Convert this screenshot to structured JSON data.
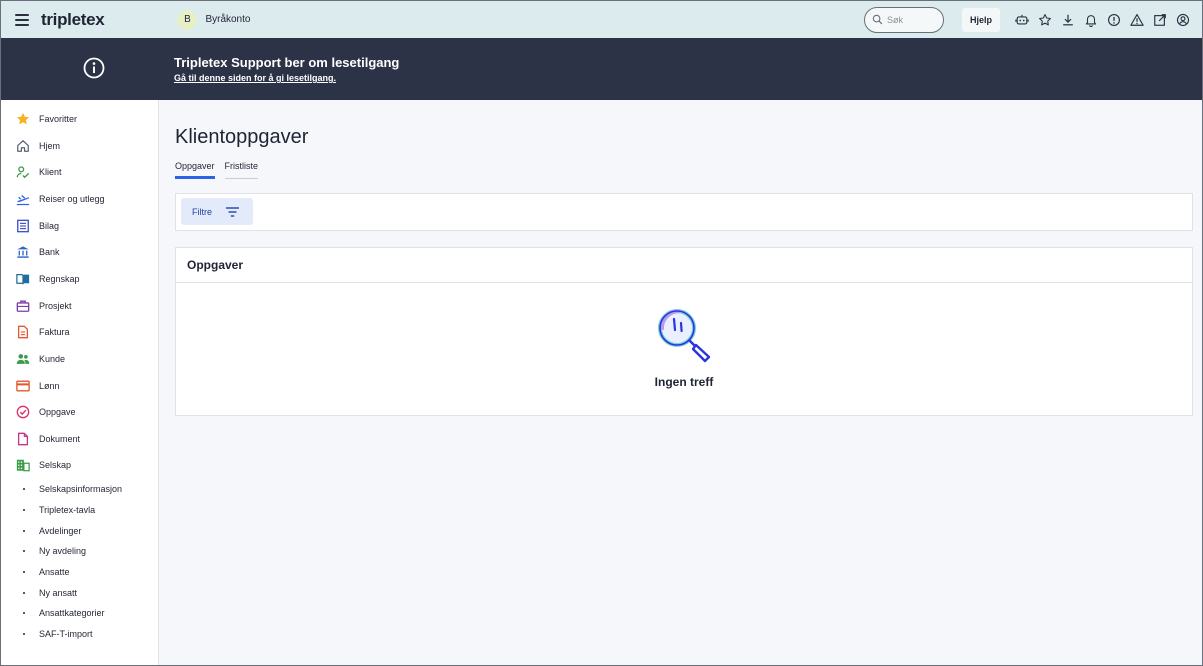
{
  "topbar": {
    "logo": "tripletex",
    "account_initial": "B",
    "account_name": "Byråkonto",
    "search_placeholder": "Søk",
    "help_label": "Hjelp",
    "icons": [
      "robot-icon",
      "star-icon",
      "download-icon",
      "bell-icon",
      "alert-circle-icon",
      "warning-icon",
      "external-link-icon",
      "account-icon"
    ]
  },
  "banner": {
    "title": "Tripletex Support ber om lesetilgang",
    "link": "Gå til denne siden for å gi lesetilgang."
  },
  "sidebar": {
    "items": [
      {
        "label": "Favoritter",
        "icon": "star-icon",
        "color": "#f5b323"
      },
      {
        "label": "Hjem",
        "icon": "home-icon",
        "color": "#5b6275"
      },
      {
        "label": "Klient",
        "icon": "client-icon",
        "color": "#3a9b4a"
      },
      {
        "label": "Reiser og utlegg",
        "icon": "plane-icon",
        "color": "#2c62e6"
      },
      {
        "label": "Bilag",
        "icon": "voucher-icon",
        "color": "#3b4fc9"
      },
      {
        "label": "Bank",
        "icon": "bank-icon",
        "color": "#2f62c7"
      },
      {
        "label": "Regnskap",
        "icon": "book-icon",
        "color": "#1e6f9c"
      },
      {
        "label": "Prosjekt",
        "icon": "briefcase-icon",
        "color": "#7b3fa8"
      },
      {
        "label": "Faktura",
        "icon": "invoice-icon",
        "color": "#e4572e"
      },
      {
        "label": "Kunde",
        "icon": "customer-icon",
        "color": "#3a9b4a"
      },
      {
        "label": "Lønn",
        "icon": "card-icon",
        "color": "#e4572e"
      },
      {
        "label": "Oppgave",
        "icon": "check-circle-icon",
        "color": "#d6336c"
      },
      {
        "label": "Dokument",
        "icon": "document-icon",
        "color": "#c0358c"
      },
      {
        "label": "Selskap",
        "icon": "building-icon",
        "color": "#3a9b4a"
      }
    ],
    "sub_items": [
      "Selskapsinformasjon",
      "Tripletex-tavla",
      "Avdelinger",
      "Ny avdeling",
      "Ansatte",
      "Ny ansatt",
      "Ansattkategorier",
      "SAF-T-import"
    ]
  },
  "main": {
    "title": "Klientoppgaver",
    "tabs": [
      {
        "label": "Oppgaver",
        "active": true
      },
      {
        "label": "Fristliste",
        "active": false
      }
    ],
    "filter_label": "Filtre",
    "card_title": "Oppgaver",
    "empty_text": "Ingen treff"
  },
  "colors": {
    "topbar_bg": "#dcebee",
    "banner_bg": "#2d3347",
    "accent": "#2c62e6"
  }
}
